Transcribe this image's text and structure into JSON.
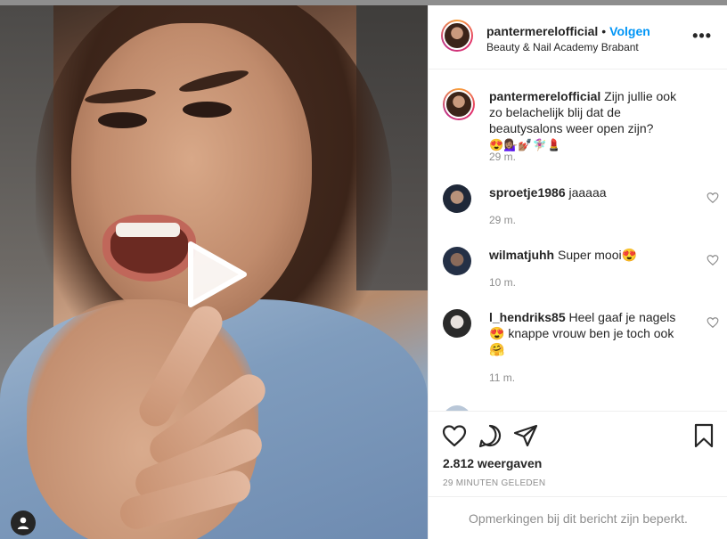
{
  "post": {
    "username": "pantermerelofficial",
    "separator": "•",
    "follow_label": "Volgen",
    "location": "Beauty & Nail Academy Brabant",
    "more_label": "•••"
  },
  "caption": {
    "username": "pantermerelofficial",
    "text": "Zijn jullie ook zo belachelijk blij dat de beautysalons weer open zijn?",
    "emojis": "😍💁🏽‍♀️💅🏽🧚🏼‍♀️💄",
    "time": "29 m."
  },
  "comments": [
    {
      "username": "sproetje1986",
      "text": "jaaaaa",
      "time": "29 m."
    },
    {
      "username": "wilmatjuhh",
      "text": "Super mooi😍",
      "time": "10 m."
    },
    {
      "username": "l_hendriks85",
      "text": "Heel gaaf je nagels 😍 knappe vrouw ben je toch ook 🤗",
      "time": "11 m."
    }
  ],
  "stats": {
    "views": "2.812 weergaven",
    "posted": "29 MINUTEN GELEDEN"
  },
  "footer": {
    "limited_notice": "Opmerkingen bij dit bericht zijn beperkt."
  },
  "icons": [
    "play-icon",
    "heart-icon",
    "comment-icon",
    "share-icon",
    "bookmark-icon",
    "user-icon",
    "more-icon"
  ]
}
